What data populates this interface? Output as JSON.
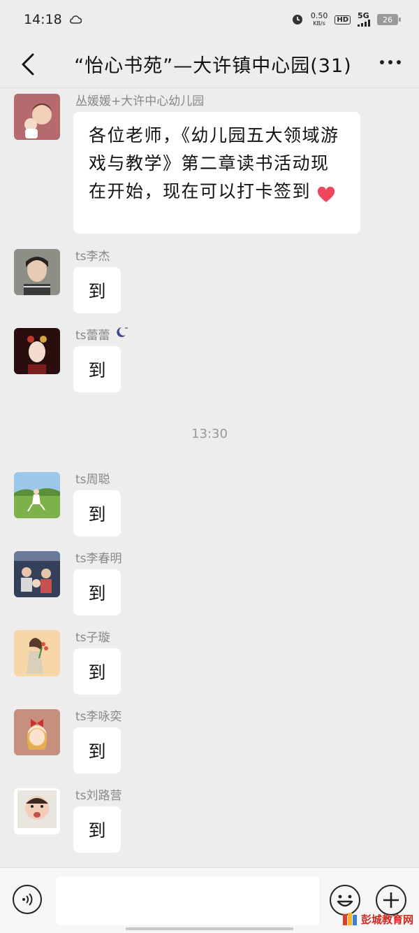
{
  "status_bar": {
    "time": "14:18",
    "net_speed_value": "0.50",
    "net_speed_unit": "KB/s",
    "hd": "HD",
    "network": "5G",
    "battery": "26"
  },
  "header": {
    "title": "“怡心书苑”—大许镇中心园(31)"
  },
  "messages": [
    {
      "sender": "丛媛媛+大许中心幼儿园",
      "text": "各位老师，《幼儿园五大领域游戏与教学》第二章读书活动现在开始，现在可以打卡签到"
    },
    {
      "sender": "ts李杰",
      "text": "到"
    },
    {
      "sender": "ts蕾蕾",
      "text": "到"
    },
    {
      "sender": "ts周聪",
      "text": "到"
    },
    {
      "sender": "ts李春明",
      "text": "到"
    },
    {
      "sender": "ts子璇",
      "text": "到"
    },
    {
      "sender": "ts李咏奕",
      "text": "到"
    },
    {
      "sender": "ts刘路营",
      "text": "到"
    }
  ],
  "time_divider": "13:30",
  "watermark": "彭城教育网",
  "colors": {
    "background": "#ededed",
    "bubble": "#ffffff",
    "heart": "#f0475f"
  }
}
